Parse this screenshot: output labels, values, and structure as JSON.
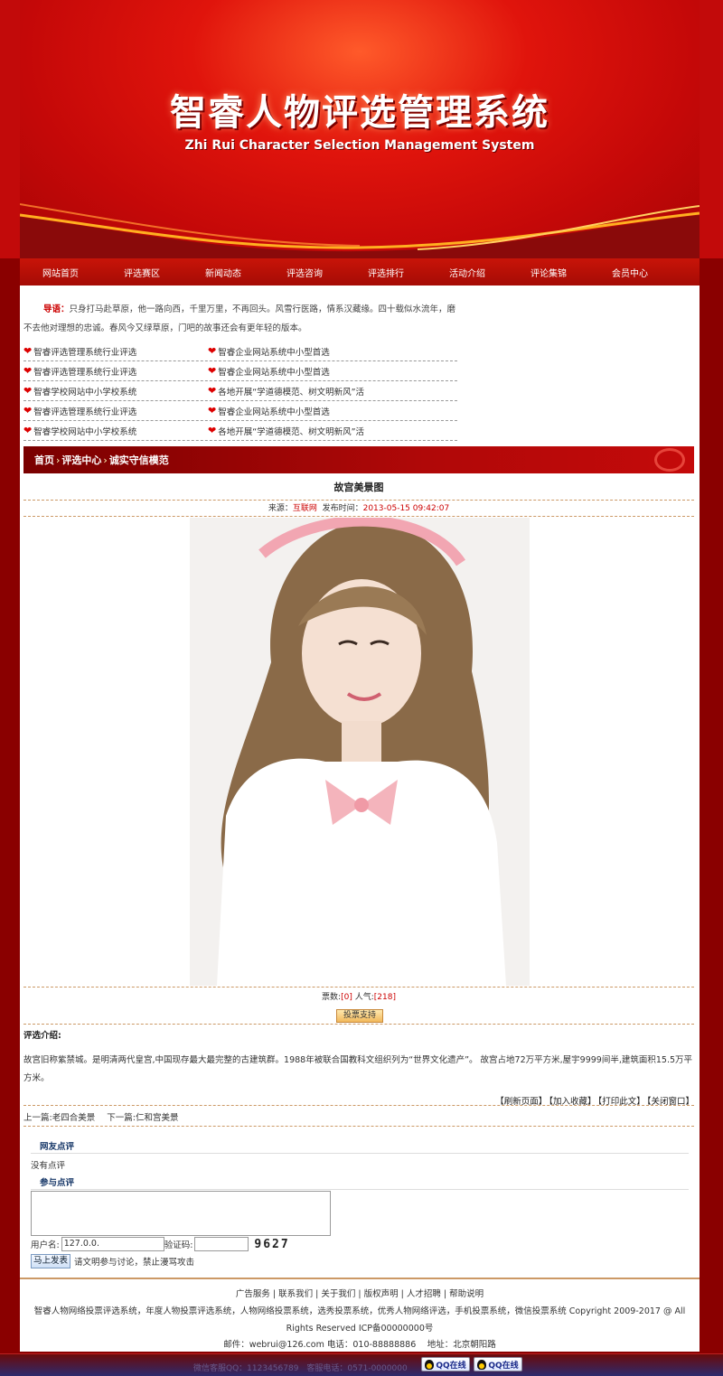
{
  "header": {
    "title": "智睿人物评选管理系统",
    "subtitle": "Zhi Rui Character Selection Management System"
  },
  "nav": [
    {
      "label": "网站首页"
    },
    {
      "label": "评选赛区"
    },
    {
      "label": "新闻动态"
    },
    {
      "label": "评选咨询"
    },
    {
      "label": "评选排行"
    },
    {
      "label": "活动介绍"
    },
    {
      "label": "评论集锦"
    },
    {
      "label": "会员中心"
    }
  ],
  "guide": {
    "label": "导语：",
    "text": "只身打马赴草原，他一路向西，千里万里，不再回头。风雪行医路，情系汉藏缘。四十载似水流年，磨不去他对理想的忠诚。春风今又绿草原，门吧的故事还会有更年轻的版本。"
  },
  "links": [
    [
      "智睿评选管理系统行业评选",
      "智睿企业网站系统中小型首选"
    ],
    [
      "智睿评选管理系统行业评选",
      "智睿企业网站系统中小型首选"
    ],
    [
      "智睿学校网站中小学校系统",
      "各地开展“学道德模范、树文明新风”活"
    ],
    [
      "智睿评选管理系统行业评选",
      "智睿企业网站系统中小型首选"
    ],
    [
      "智睿学校网站中小学校系统",
      "各地开展“学道德模范、树文明新风”活"
    ]
  ],
  "breadcrumb": {
    "home": "首页",
    "sep": "›",
    "section": "评选中心",
    "current": "诚实守信模范"
  },
  "article": {
    "title": "故宫美景图",
    "source_label": "来源：",
    "source": "互联网",
    "time_label": "发布时间：",
    "time": "2013-05-15 09:42:07",
    "votes_label": "票数:",
    "votes": "[0]",
    "popularity_label": "人气:",
    "popularity": "[218]",
    "vote_button": "投票支持",
    "intro_label": "评选介绍:",
    "intro": "故宫旧称紫禁城。是明清两代皇宫,中国现存最大最完整的古建筑群。1988年被联合国教科文组织列为“世界文化遗产”。 故宫占地72万平方米,屋宇9999间半,建筑面积15.5万平方米。"
  },
  "tools": [
    "【刷新页面】",
    "【加入收藏】",
    "【打印此文】",
    "【关闭窗口】"
  ],
  "prev_next": {
    "prev_label": "上一篇:",
    "prev": "老四合美景",
    "next_label": "下一篇:",
    "next": "仁和宫美景"
  },
  "comments": {
    "heading": "网友点评",
    "empty": "没有点评",
    "form_heading": "参与点评",
    "user_label": "用户名:",
    "user_value": "127.0.0.",
    "code_label": "验证码:",
    "captcha": "9627",
    "submit": "马上发表",
    "notice": "请文明参与讨论，禁止漫骂攻击"
  },
  "footer": {
    "links": "广告服务 | 联系我们 | 关于我们 | 版权声明 | 人才招聘 | 帮助说明",
    "desc": "智睿人物网络投票评选系统，年度人物投票评选系统，人物网络投票系统，选秀投票系统，优秀人物网络评选，手机投票系统，微信投票系统 Copyright 2009-2017 @ All Rights Reserved ICP备00000000号",
    "contact": "邮件：webrui@126.com 电话：010-88888886　 地址：北京朝阳路",
    "bottom_text": "微信客服QQ：1123456789　客服电话：0571-0000000",
    "qq1": "QQ在线",
    "qq2": "QQ在线"
  },
  "colors": {
    "brand_red": "#c40808",
    "page_bg": "#8a0000",
    "accent_link": "#c00000"
  }
}
